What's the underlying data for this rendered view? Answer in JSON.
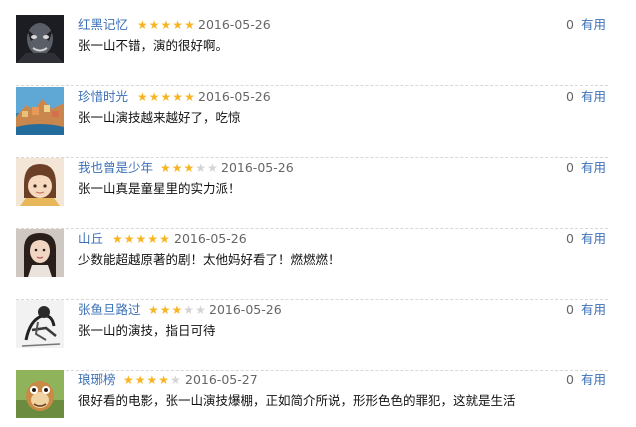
{
  "comments": [
    {
      "username": "红黑记忆",
      "stars_filled": 5,
      "stars_total": 5,
      "date": "2016-05-26",
      "text": "张一山不错，演的很好啊。",
      "useful_count": "0",
      "useful_label": "有用",
      "avatar": "avatar-dark-face"
    },
    {
      "username": "珍惜时光",
      "stars_filled": 5,
      "stars_total": 5,
      "date": "2016-05-26",
      "text": "张一山演技越来越好了，吃惊",
      "useful_count": "0",
      "useful_label": "有用",
      "avatar": "avatar-coastal-village"
    },
    {
      "username": "我也曾是少年",
      "stars_filled": 3,
      "stars_total": 5,
      "date": "2016-05-26",
      "text": "张一山真是童星里的实力派！",
      "useful_count": "0",
      "useful_label": "有用",
      "avatar": "avatar-cartoon-girl"
    },
    {
      "username": "山丘",
      "stars_filled": 5,
      "stars_total": 5,
      "date": "2016-05-26",
      "text": "少数能超越原著的剧！太他妈好看了！燃燃燃！",
      "useful_count": "0",
      "useful_label": "有用",
      "avatar": "avatar-woman-portrait"
    },
    {
      "username": "张鱼旦路过",
      "stars_filled": 3,
      "stars_total": 5,
      "date": "2016-05-26",
      "text": "张一山的演技，指日可待",
      "useful_count": "0",
      "useful_label": "有用",
      "avatar": "avatar-bw-sketch"
    },
    {
      "username": "琅琊榜",
      "stars_filled": 4,
      "stars_total": 5,
      "date": "2016-05-27",
      "text": "很好看的电影，张一山演技爆棚，正如简介所说，形形色色的罪犯，这就是生活",
      "useful_count": "0",
      "useful_label": "有用",
      "avatar": "avatar-cartoon-character"
    }
  ],
  "colors": {
    "link": "#3b6fb6",
    "star_on": "#f7b524",
    "star_off": "#d4d4d4",
    "separator": "#d8d8d8"
  }
}
